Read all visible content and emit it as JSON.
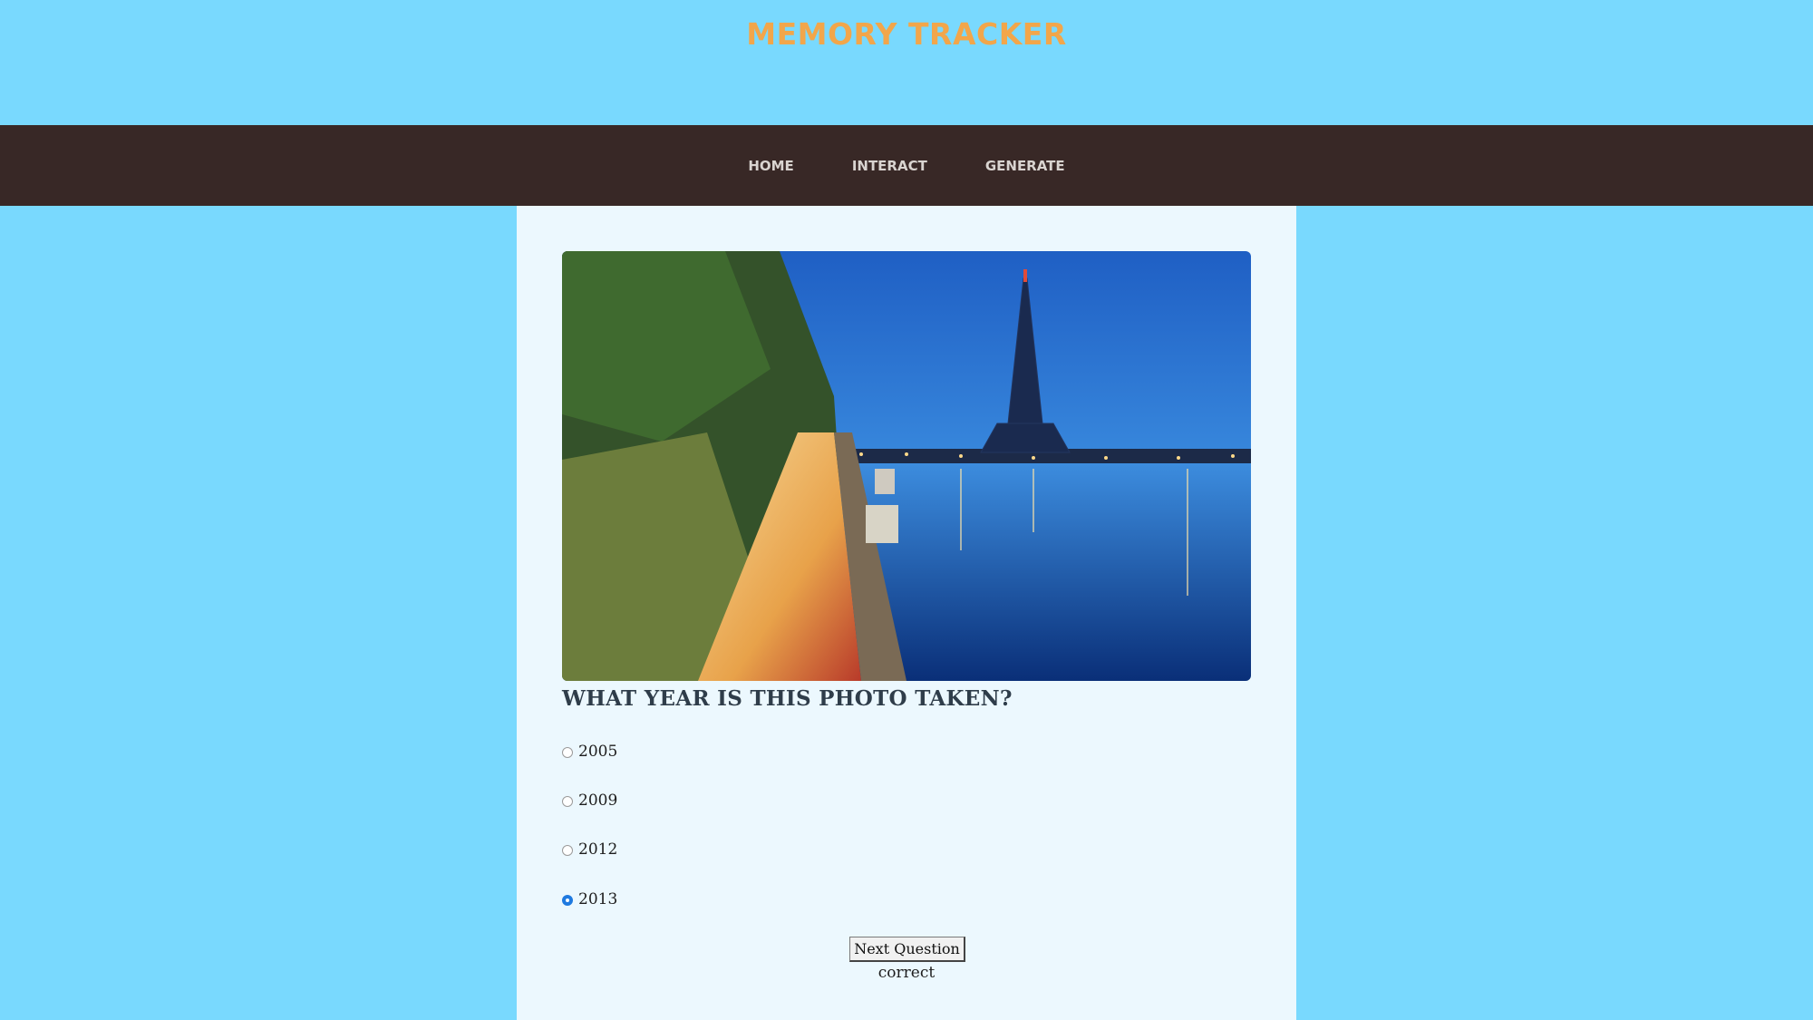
{
  "header": {
    "title": "MEMORY TRACKER"
  },
  "nav": {
    "items": [
      "HOME",
      "INTERACT",
      "GENERATE"
    ]
  },
  "quiz": {
    "photo_alt": "Eiffel Tower at dusk",
    "question": "WHAT YEAR IS THIS PHOTO TAKEN?",
    "options": [
      "2005",
      "2009",
      "2012",
      "2013"
    ],
    "selected": "2013",
    "next_label": "Next Question",
    "result": "correct"
  },
  "colors": {
    "background": "#79d9fe",
    "title": "#f2a64a",
    "navbar": "#382826",
    "panel": "#ecf8fe",
    "question": "#2f3d4a"
  }
}
